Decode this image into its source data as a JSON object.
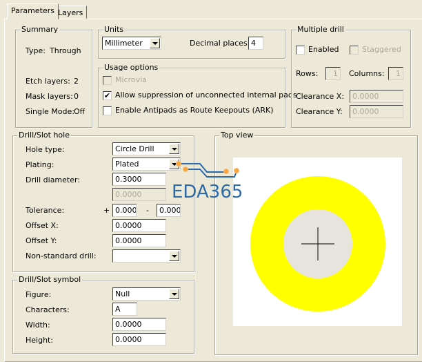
{
  "tabs": [
    "Parameters",
    "Layers"
  ],
  "summary": {
    "title": "Summary",
    "type_label": "Type:",
    "type_value": "Through",
    "etch_label": "Etch layers:",
    "etch_value": "2",
    "mask_label": "Mask layers:",
    "mask_value": "0",
    "single_label": "Single Mode:",
    "single_value": "Off"
  },
  "units": {
    "title": "Units",
    "unit": "Millimeter",
    "decimal_label": "Decimal places:",
    "decimal_value": "4"
  },
  "usage": {
    "title": "Usage options",
    "microvia": "Microvia",
    "allow": "Allow suppression of unconnected internal pads",
    "allow_checked": true,
    "antipads": "Enable Antipads as Route Keepouts (ARK)"
  },
  "multi": {
    "title": "Multiple drill",
    "enabled": "Enabled",
    "staggered": "Staggered",
    "rows_label": "Rows:",
    "rows_value": "1",
    "cols_label": "Columns:",
    "cols_value": "1",
    "clx_label": "Clearance X:",
    "clx_value": "0.0000",
    "cly_label": "Clearance Y:",
    "cly_value": "0.0000"
  },
  "hole": {
    "title": "Drill/Slot hole",
    "hole_type_label": "Hole type:",
    "hole_type": "Circle Drill",
    "plating_label": "Plating:",
    "plating": "Plated",
    "diam_label": "Drill diameter:",
    "diam": "0.3000",
    "diam2": "0.0000",
    "tol_label": "Tolerance:",
    "plus": "+",
    "tol_plus": "0.000",
    "minus": "-",
    "tol_minus": "0.000",
    "offx_label": "Offset X:",
    "offx": "0.0000",
    "offy_label": "Offset Y:",
    "offy": "0.0000",
    "nonstd_label": "Non-standard drill:",
    "nonstd": ""
  },
  "symbol": {
    "title": "Drill/Slot symbol",
    "figure_label": "Figure:",
    "figure": "Null",
    "chars_label": "Characters:",
    "chars": "A",
    "width_label": "Width:",
    "width": "0.0000",
    "height_label": "Height:",
    "height": "0.0000"
  },
  "topview": {
    "title": "Top view",
    "pad_color": "#ffff00"
  },
  "watermark": "EDA365"
}
